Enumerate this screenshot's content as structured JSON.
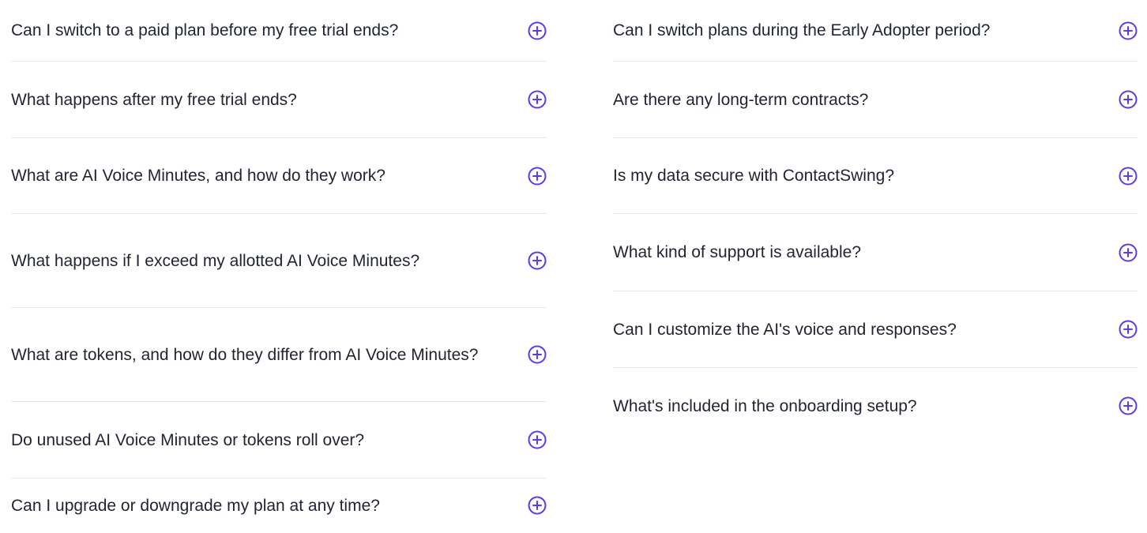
{
  "faq": {
    "left": [
      {
        "question": "Can I switch to a paid plan before my free trial ends?"
      },
      {
        "question": "What happens after my free trial ends?"
      },
      {
        "question": "What are AI Voice Minutes, and how do they work?"
      },
      {
        "question": "What happens if I exceed my allotted AI Voice Minutes?"
      },
      {
        "question": "What are tokens, and how do they differ from AI Voice Minutes?"
      },
      {
        "question": "Do unused AI Voice Minutes or tokens roll over?"
      },
      {
        "question": "Can I upgrade or downgrade my plan at any time?"
      }
    ],
    "right": [
      {
        "question": "Can I switch plans during the Early Adopter period?"
      },
      {
        "question": "Are there any long-term contracts?"
      },
      {
        "question": "Is my data secure with ContactSwing?"
      },
      {
        "question": "What kind of support is available?"
      },
      {
        "question": "Can I customize the AI's voice and responses?"
      },
      {
        "question": "What's included in the onboarding setup?"
      }
    ]
  },
  "icons": {
    "expand": "plus-circle-icon"
  },
  "colors": {
    "accent": "#5b3bf0",
    "text": "#1f2430",
    "divider": "#e6e8ee"
  }
}
